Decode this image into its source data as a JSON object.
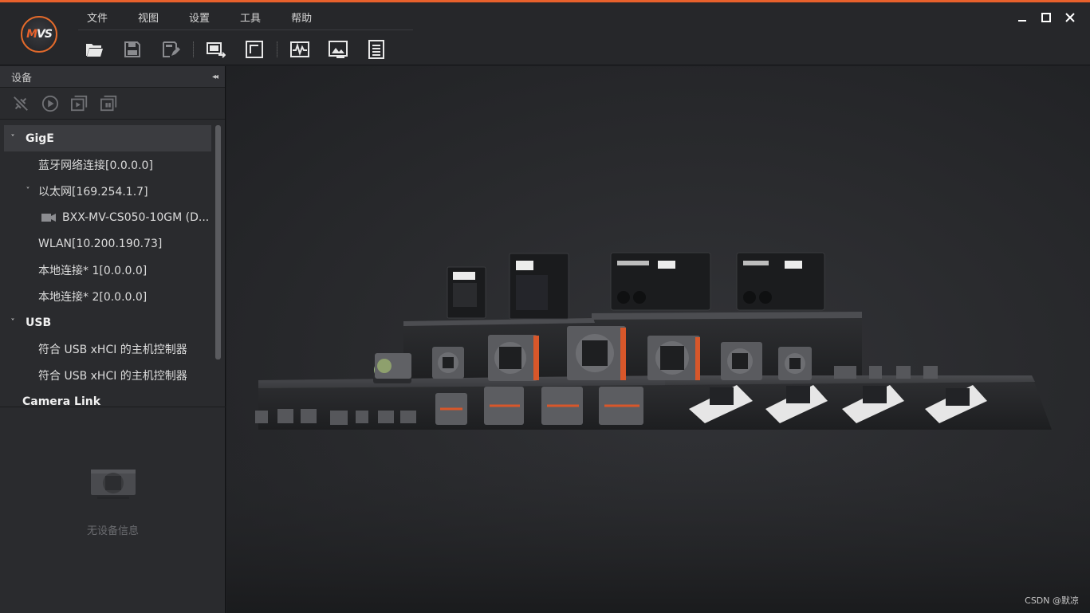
{
  "app": {
    "logo_text": "MVS"
  },
  "menu": [
    "文件",
    "视图",
    "设置",
    "工具",
    "帮助"
  ],
  "toolbar_icons": [
    "open-folder-icon",
    "save-icon",
    "save-as-icon",
    "multi-display-icon",
    "single-display-icon",
    "waveform-icon",
    "image-edit-icon",
    "notes-icon"
  ],
  "window_controls": {
    "minimize": "▁",
    "maximize": "☐",
    "close": "✕"
  },
  "sidebar": {
    "title": "设备",
    "collapse_glyph": "◂◂",
    "tools": [
      "disconnect-icon",
      "play-icon",
      "grab-icon",
      "stop-grab-icon"
    ],
    "tree": [
      {
        "label": "GigE",
        "type": "group",
        "expanded": true,
        "caret": "˅"
      },
      {
        "label": "蓝牙网络连接[0.0.0.0]",
        "type": "adapter"
      },
      {
        "label": "以太网[169.254.1.7]",
        "type": "adapter",
        "expanded": true,
        "caret": "˅"
      },
      {
        "label": "BXX-MV-CS050-10GM (D...",
        "type": "camera"
      },
      {
        "label": "WLAN[10.200.190.73]",
        "type": "adapter"
      },
      {
        "label": "本地连接* 1[0.0.0.0]",
        "type": "adapter"
      },
      {
        "label": "本地连接* 2[0.0.0.0]",
        "type": "adapter"
      },
      {
        "label": "USB",
        "type": "group",
        "expanded": true,
        "caret": "˅"
      },
      {
        "label": "符合 USB xHCI 的主机控制器",
        "type": "adapter"
      },
      {
        "label": "符合 USB xHCI 的主机控制器",
        "type": "adapter"
      },
      {
        "label": "Camera Link",
        "type": "group"
      }
    ],
    "no_device_text": "无设备信息"
  },
  "watermark": "CSDN @默凉",
  "colors": {
    "accent": "#e8612c",
    "background": "#1e1f22",
    "panel": "#2a2b2e"
  }
}
